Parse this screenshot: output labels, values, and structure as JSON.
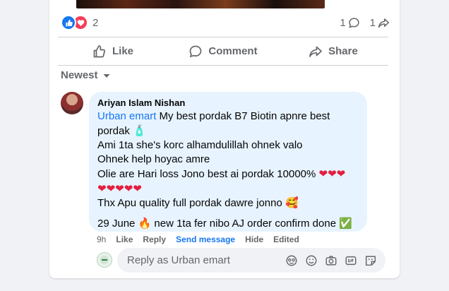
{
  "post": {
    "reactions_count": "2",
    "comment_count": "1",
    "share_count": "1"
  },
  "actions": {
    "like": "Like",
    "comment": "Comment",
    "share": "Share"
  },
  "sort": {
    "label": "Newest"
  },
  "comment": {
    "author": "Ariyan Islam Nishan",
    "mention": "Urban emart",
    "line1_rest": " My best pordak B7 Biotin apnre best",
    "line2": "pordak ",
    "line2_emoji": "🧴",
    "line3": "Ami 1ta she's korc alhamdulillah ohnek valo",
    "line4": "Ohnek help hoyac amre",
    "line5": "Olie are Hari loss Jono best ai pordak 10000% ",
    "hearts_a": "❤❤❤",
    "hearts_b": "❤❤❤❤❤",
    "line7": "Thx Apu quality full pordak dawre jonno ",
    "line7_emoji": "🥰",
    "line8a": "29 June ",
    "line8_fire": "🔥",
    "line8b": " new 1ta fer nibo AJ order confirm done ",
    "line8_check": "✅"
  },
  "meta": {
    "time": "9h",
    "like": "Like",
    "reply": "Reply",
    "send": "Send message",
    "hide": "Hide",
    "edited": "Edited"
  },
  "reply": {
    "placeholder": "Reply as Urban emart"
  },
  "colors": {
    "accent": "#1877f2",
    "bubble": "#e7f3ff",
    "love": "#f33e58"
  }
}
